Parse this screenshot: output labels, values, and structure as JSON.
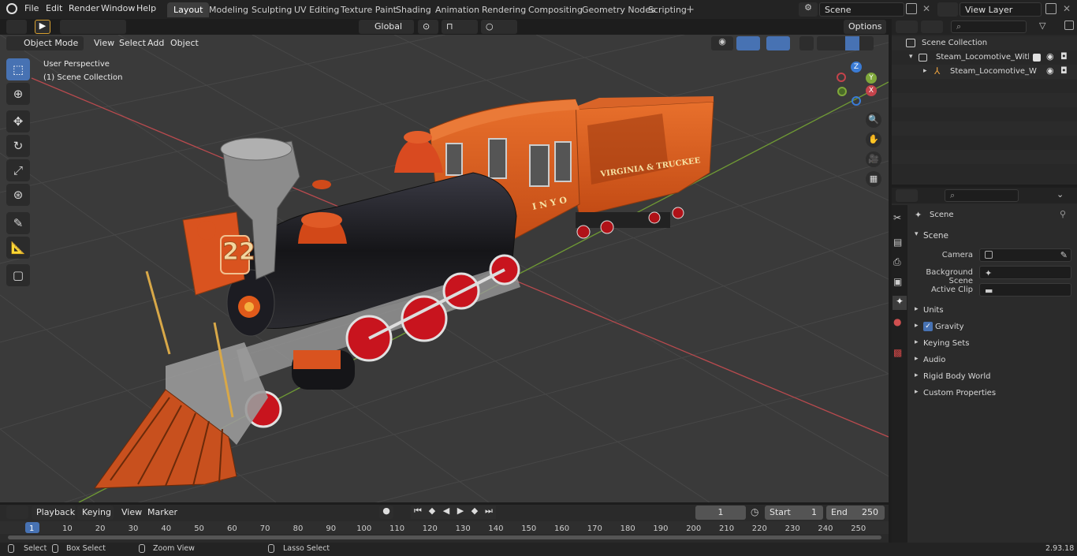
{
  "menu": {
    "items": [
      "File",
      "Edit",
      "Render",
      "Window",
      "Help"
    ]
  },
  "workspaces": [
    "Layout",
    "Modeling",
    "Sculpting",
    "UV Editing",
    "Texture Paint",
    "Shading",
    "Animation",
    "Rendering",
    "Compositing",
    "Geometry Nodes",
    "Scripting"
  ],
  "active_workspace": "Layout",
  "scene_field": "Scene",
  "view_layer_field": "View Layer",
  "viewport_header": {
    "mode": "Object Mode",
    "menus": [
      "View",
      "Select",
      "Add",
      "Object"
    ],
    "orientation": "Global",
    "options": "Options"
  },
  "viewport_overlay": {
    "perspective": "User Perspective",
    "collection": "(1) Scene Collection"
  },
  "gizmo": {
    "z": "Z",
    "y": "Y",
    "x": "X"
  },
  "model_text": {
    "number": "22",
    "cab_name": "INYO",
    "tender_name": "VIRGINIA & TRUCKEE"
  },
  "outliner": {
    "root": "Scene Collection",
    "items": [
      {
        "label": "Steam_Locomotive_With_Coa",
        "level": 1
      },
      {
        "label": "Steam_Locomotive_With",
        "level": 2
      }
    ]
  },
  "properties": {
    "header": "Scene",
    "section": "Scene",
    "fields": [
      {
        "label": "Camera",
        "value": ""
      },
      {
        "label": "Background Scene",
        "value": ""
      },
      {
        "label": "Active Clip",
        "value": ""
      }
    ],
    "subpanels": [
      "Units",
      "Gravity",
      "Keying Sets",
      "Audio",
      "Rigid Body World",
      "Custom Properties"
    ],
    "gravity_checked": true
  },
  "timeline": {
    "menus": [
      "Playback",
      "Keying",
      "View",
      "Marker"
    ],
    "current_frame": "1",
    "start_label": "Start",
    "start_value": "1",
    "end_label": "End",
    "end_value": "250",
    "ruler": [
      "1",
      "10",
      "20",
      "30",
      "40",
      "50",
      "60",
      "70",
      "80",
      "90",
      "100",
      "110",
      "120",
      "130",
      "140",
      "150",
      "160",
      "170",
      "180",
      "190",
      "200",
      "210",
      "220",
      "230",
      "240",
      "250"
    ]
  },
  "statusbar": {
    "select": "Select",
    "box_select": "Box Select",
    "zoom_view": "Zoom View",
    "lasso_select": "Lasso Select",
    "version": "2.93.18"
  },
  "colors": {
    "accent": "#4772b3",
    "locomotive_orange": "#d95a1e",
    "boiler_black": "#1a1a1e",
    "wheel_red": "#c8141e",
    "x_axis": "#c4434b",
    "y_axis": "#7fa83a",
    "z_axis": "#3a7bd5"
  }
}
